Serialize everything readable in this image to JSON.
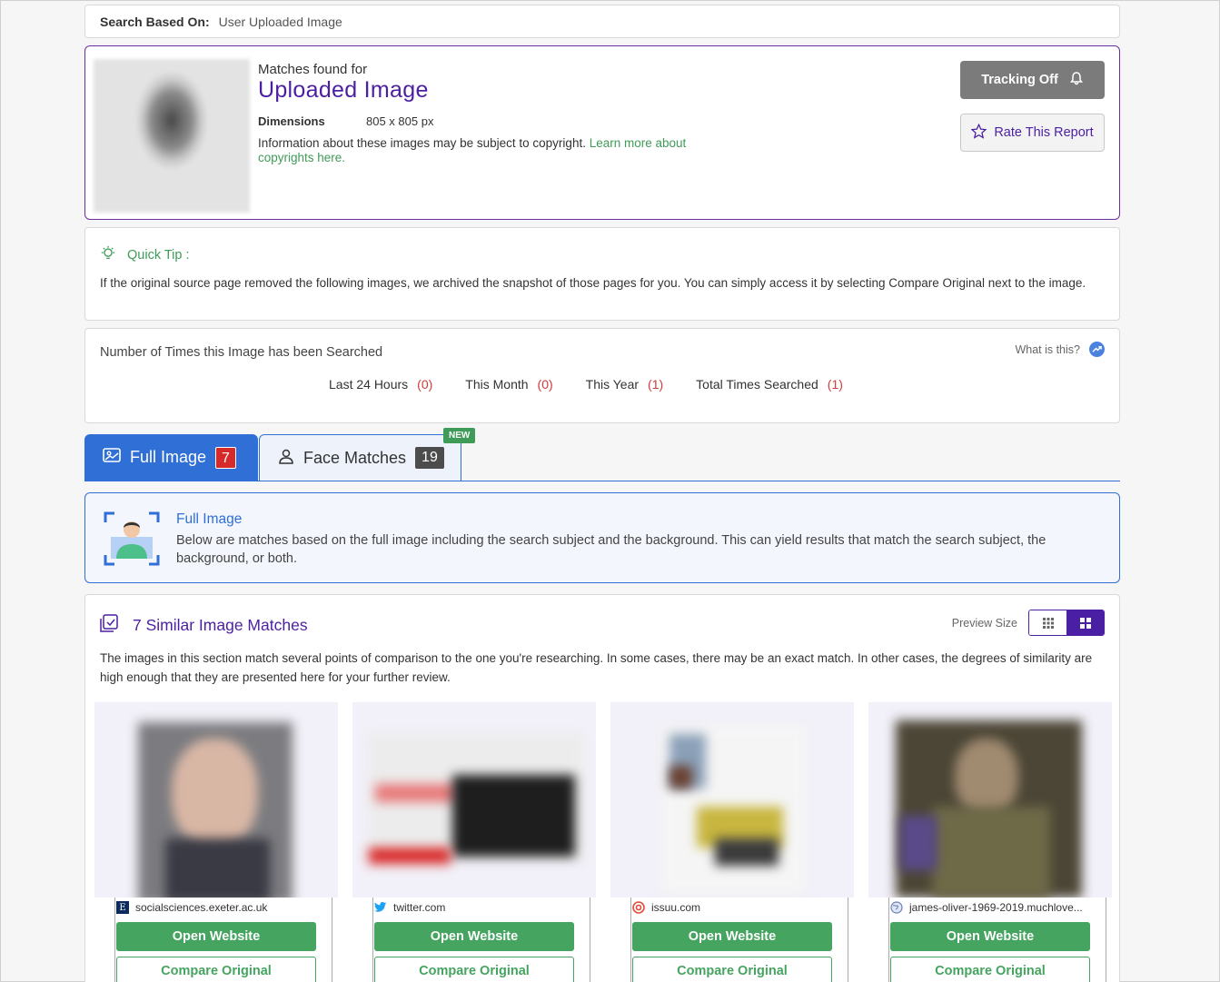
{
  "search_based": {
    "label": "Search Based On:",
    "value": "User Uploaded Image"
  },
  "match_header": {
    "label": "Matches found for",
    "title": "Uploaded Image",
    "dimensions_label": "Dimensions",
    "dimensions_value": "805 x 805 px",
    "copyright_text": "Information about these images may be subject to copyright.",
    "copyright_link": "Learn more about copyrights here.",
    "tracking_label": "Tracking Off",
    "rate_label": "Rate This Report"
  },
  "quick_tip": {
    "title": "Quick Tip :",
    "text": "If the original source page removed the following images, we archived the snapshot of those pages for you. You can simply access it by selecting Compare Original next to the image."
  },
  "search_count": {
    "title": "Number of Times this Image has been Searched",
    "what_is": "What is this?",
    "stats": [
      {
        "label": "Last 24 Hours",
        "value": "(0)"
      },
      {
        "label": "This Month",
        "value": "(0)"
      },
      {
        "label": "This Year",
        "value": "(1)"
      },
      {
        "label": "Total Times Searched",
        "value": "(1)"
      }
    ]
  },
  "tabs": {
    "full_label": "Full Image",
    "full_count": "7",
    "face_label": "Face Matches",
    "face_count": "19",
    "new_badge": "NEW"
  },
  "full_image_info": {
    "title": "Full Image",
    "text": "Below are matches based on the full image including the search subject and the background. This can yield results that match the search subject, the background, or both."
  },
  "results": {
    "title": "7 Similar Image Matches",
    "preview_label": "Preview Size",
    "text": "The images in this section match several points of comparison to the one you're researching. In some cases, there may be an exact match. In other cases, the degrees of similarity are high enough that they are presented here for your further review.",
    "items": [
      {
        "source": "socialsciences.exeter.ac.uk",
        "open": "Open Website",
        "compare": "Compare Original"
      },
      {
        "source": "twitter.com",
        "open": "Open Website",
        "compare": "Compare Original"
      },
      {
        "source": "issuu.com",
        "open": "Open Website",
        "compare": "Compare Original"
      },
      {
        "source": "james-oliver-1969-2019.muchlove...",
        "open": "Open Website",
        "compare": "Compare Original"
      }
    ]
  },
  "colors": {
    "purple": "#4b1fa3",
    "blue": "#2f6fd6",
    "green": "#45a460",
    "red": "#d23a3a"
  }
}
